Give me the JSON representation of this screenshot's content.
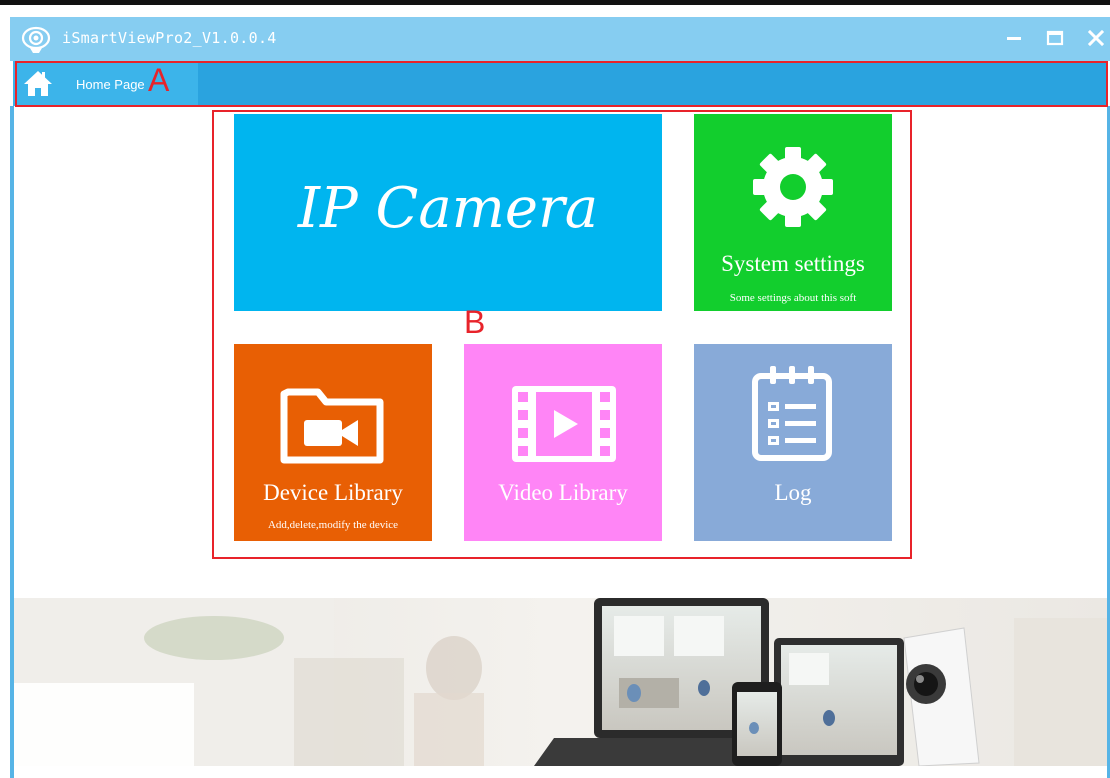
{
  "window": {
    "title": "iSmartViewPro2_V1.0.0.4",
    "icons": {
      "app": "camera-logo-icon",
      "minimize": "minimize-icon",
      "maximize": "maximize-icon",
      "close": "close-icon"
    }
  },
  "nav": {
    "home_label": "Home Page",
    "home_icon": "home-icon"
  },
  "annotations": {
    "a": "A",
    "b": "B"
  },
  "tiles": {
    "camera": {
      "title": "IP Camera",
      "color": "#00b5ef"
    },
    "settings": {
      "title": "System settings",
      "subtitle": "Some settings about this soft",
      "color": "#12ce2d",
      "icon": "gear-icon"
    },
    "device": {
      "title": "Device Library",
      "subtitle": "Add,delete,modify the device",
      "color": "#e85f04",
      "icon": "folder-camera-icon"
    },
    "video": {
      "title": "Video Library",
      "color": "#ff85f6",
      "icon": "film-play-icon"
    },
    "log": {
      "title": "Log",
      "color": "#88aad8",
      "icon": "notepad-list-icon"
    }
  },
  "colors": {
    "titlebar": "#86cdf1",
    "navbar": "#2aa3df",
    "annotation": "#e8232a"
  }
}
